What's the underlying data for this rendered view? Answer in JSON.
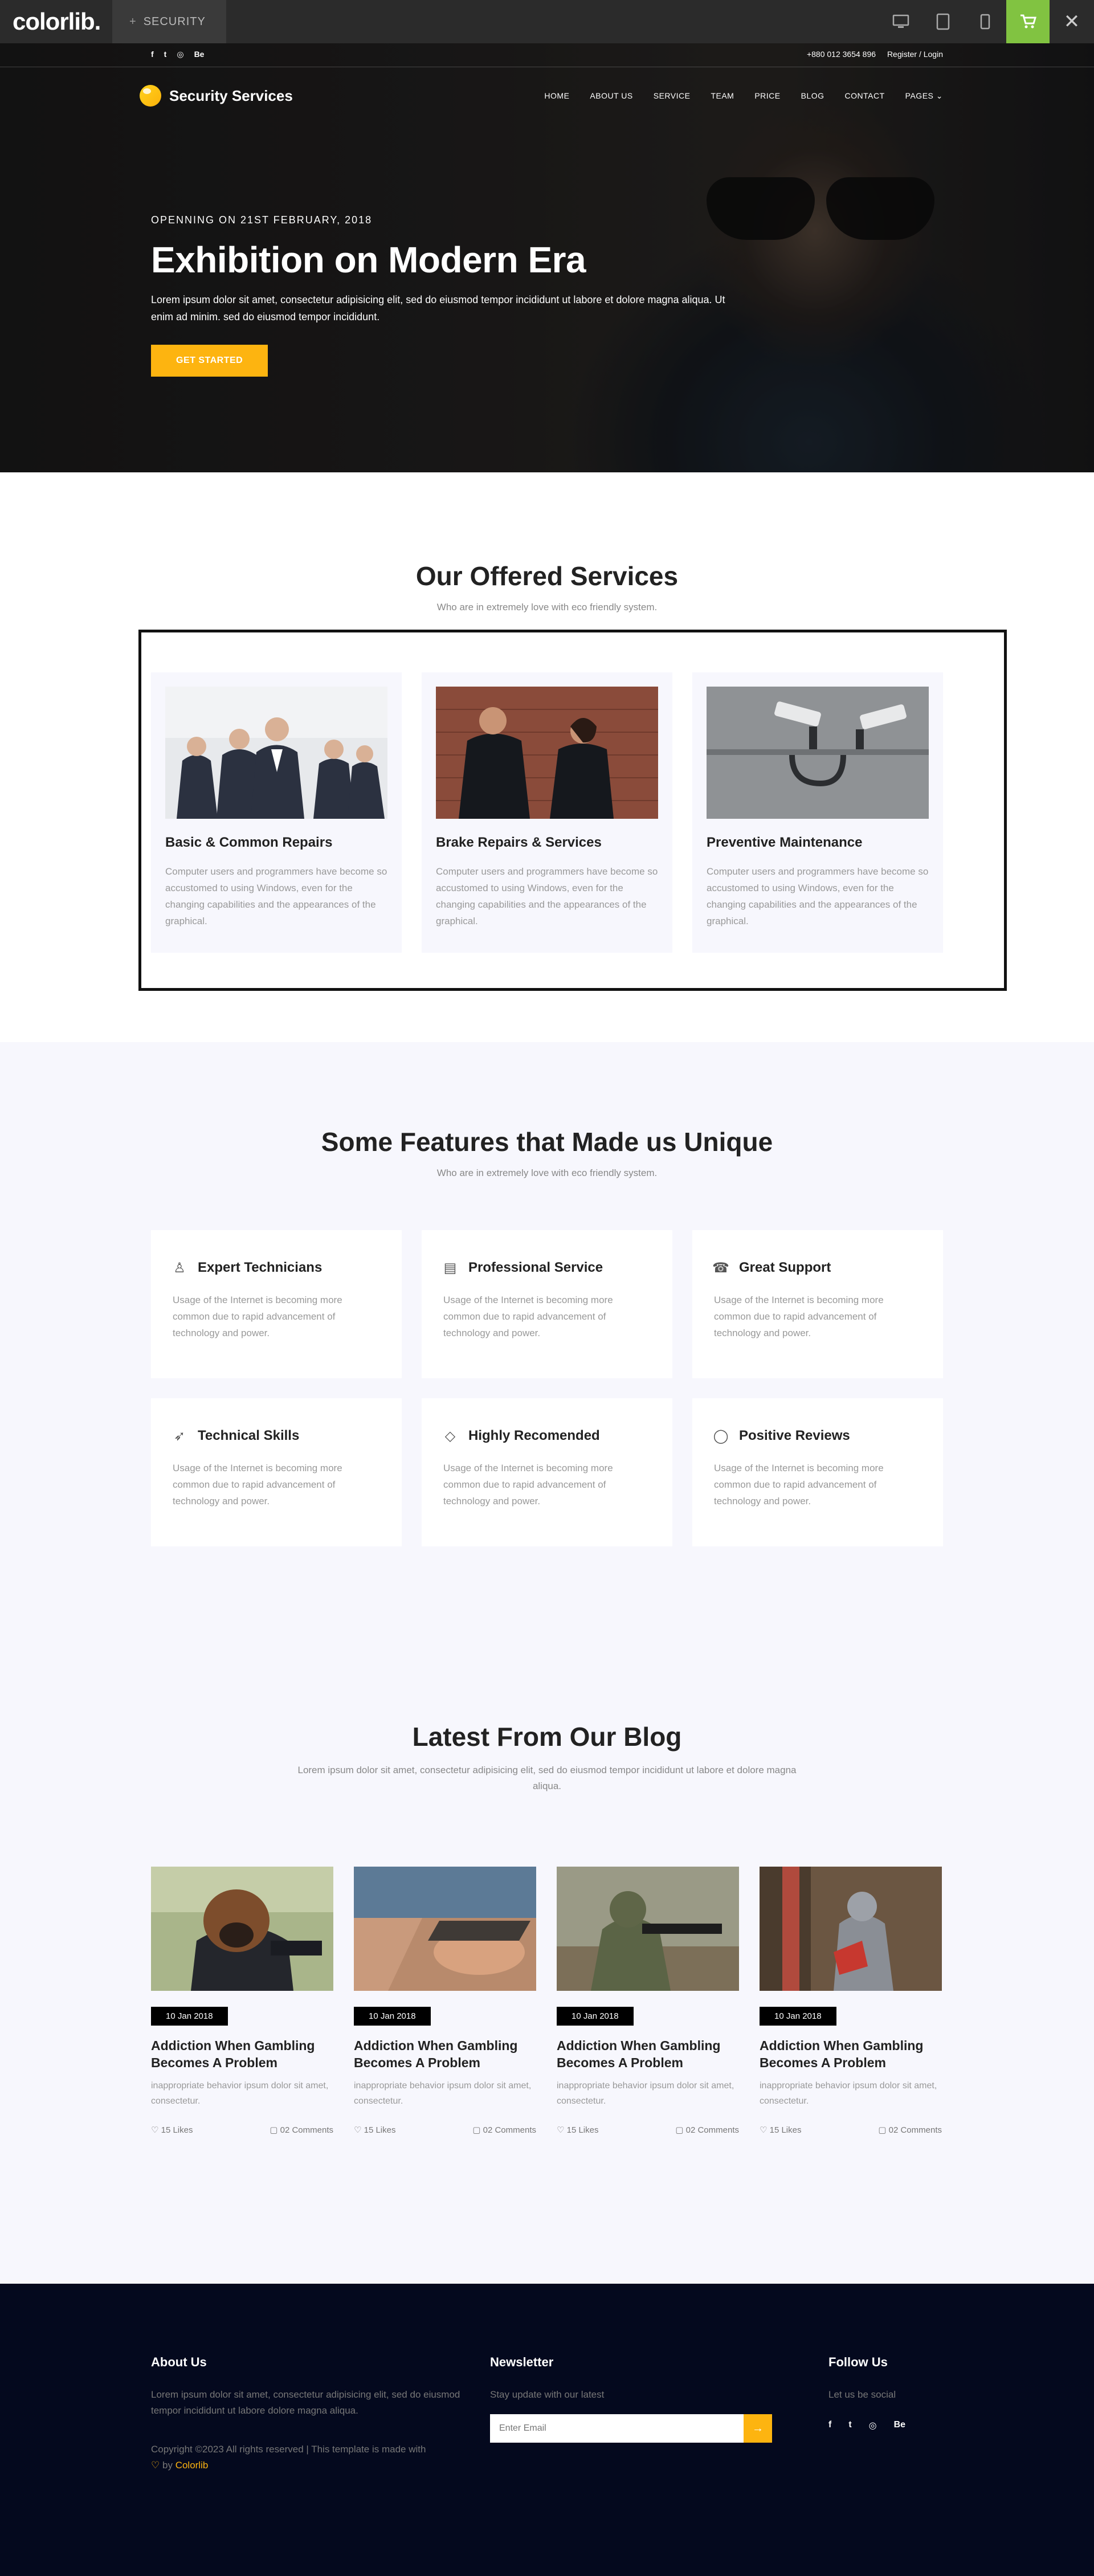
{
  "demo_bar": {
    "logo": "colorlib.",
    "theme_label": "SECURITY",
    "plus": "+",
    "close": "✕",
    "cart_color": "#81c341"
  },
  "top_header": {
    "social": [
      "f",
      "t",
      "◎",
      "Be"
    ],
    "phone": "+880 012 3654 896",
    "account": "Register / Login"
  },
  "nav": {
    "brand": "Security Services",
    "links": [
      "HOME",
      "ABOUT US",
      "SERVICE",
      "TEAM",
      "PRICE",
      "BLOG",
      "CONTACT",
      "PAGES ⌄"
    ]
  },
  "hero": {
    "subtitle": "OPENNING ON 21ST FEBRUARY, 2018",
    "title": "Exhibition on Modern Era",
    "text": "Lorem ipsum dolor sit amet, consectetur adipisicing elit, sed do eiusmod tempor incididunt ut labore et dolore magna aliqua. Ut enim ad minim. sed do eiusmod tempor incididunt.",
    "button": "GET STARTED",
    "accent": "#fdb410"
  },
  "services": {
    "title": "Our Offered Services",
    "subtitle": "Who are in extremely love with eco friendly system.",
    "items": [
      {
        "name": "Basic & Common Repairs",
        "desc": "Computer users and programmers have become so accustomed to using Windows, even for the changing capabilities and the appearances of the graphical."
      },
      {
        "name": "Brake Repairs & Services",
        "desc": "Computer users and programmers have become so accustomed to using Windows, even for the changing capabilities and the appearances of the graphical."
      },
      {
        "name": "Preventive Maintenance",
        "desc": "Computer users and programmers have become so accustomed to using Windows, even for the changing capabilities and the appearances of the graphical."
      }
    ]
  },
  "features": {
    "title": "Some Features that Made us Unique",
    "subtitle": "Who are in extremely love with eco friendly system.",
    "items": [
      {
        "icon": "user-icon",
        "glyph": "♙",
        "name": "Expert Technicians",
        "desc": "Usage of the Internet is becoming more common due to rapid advancement of technology and power."
      },
      {
        "icon": "license-icon",
        "glyph": "▤",
        "name": "Professional Service",
        "desc": "Usage of the Internet is becoming more common due to rapid advancement of technology and power."
      },
      {
        "icon": "phone-icon",
        "glyph": "☎",
        "name": "Great Support",
        "desc": "Usage of the Internet is becoming more common due to rapid advancement of technology and power."
      },
      {
        "icon": "rocket-icon",
        "glyph": "➶",
        "name": "Technical Skills",
        "desc": "Usage of the Internet is becoming more common due to rapid advancement of technology and power."
      },
      {
        "icon": "diamond-icon",
        "glyph": "◇",
        "name": "Highly Recomended",
        "desc": "Usage of the Internet is becoming more common due to rapid advancement of technology and power."
      },
      {
        "icon": "bubble-icon",
        "glyph": "◯",
        "name": "Positive Reviews",
        "desc": "Usage of the Internet is becoming more common due to rapid advancement of technology and power."
      }
    ]
  },
  "blog": {
    "title": "Latest From Our Blog",
    "subtitle": "Lorem ipsum dolor sit amet, consectetur adipisicing elit, sed do eiusmod tempor incididunt ut labore et dolore magna aliqua.",
    "posts": [
      {
        "date": "10 Jan 2018",
        "title": "Addiction When Gambling Becomes A Problem",
        "desc": "inappropriate behavior ipsum dolor sit amet, consectetur.",
        "likes": "♡ 15 Likes",
        "comments": "▢ 02 Comments"
      },
      {
        "date": "10 Jan 2018",
        "title": "Addiction When Gambling Becomes A Problem",
        "desc": "inappropriate behavior ipsum dolor sit amet, consectetur.",
        "likes": "♡ 15 Likes",
        "comments": "▢ 02 Comments"
      },
      {
        "date": "10 Jan 2018",
        "title": "Addiction When Gambling Becomes A Problem",
        "desc": "inappropriate behavior ipsum dolor sit amet, consectetur.",
        "likes": "♡ 15 Likes",
        "comments": "▢ 02 Comments"
      },
      {
        "date": "10 Jan 2018",
        "title": "Addiction When Gambling Becomes A Problem",
        "desc": "inappropriate behavior ipsum dolor sit amet, consectetur.",
        "likes": "♡ 15 Likes",
        "comments": "▢ 02 Comments"
      }
    ]
  },
  "footer": {
    "about_title": "About Us",
    "about_text": "Lorem ipsum dolor sit amet, consectetur adipisicing elit, sed do eiusmod tempor incididunt ut labore dolore magna aliqua.",
    "copyright_pre": "Copyright ©2023 All rights reserved | This template is made with",
    "heart": "♡",
    "copyright_by": "by",
    "copyright_brand": "Colorlib",
    "news_title": "Newsletter",
    "news_text": "Stay update with our latest",
    "news_placeholder": "Enter Email",
    "news_button": "→",
    "follow_title": "Follow Us",
    "follow_text": "Let us be social",
    "social": [
      "f",
      "t",
      "◎",
      "Be"
    ]
  }
}
